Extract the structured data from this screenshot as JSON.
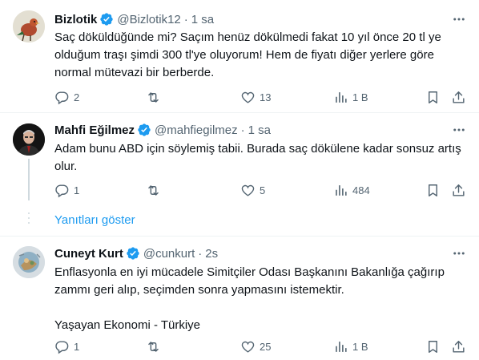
{
  "tweets": [
    {
      "name": "Bizlotik",
      "handle": "@Bizlotik12",
      "dot": "·",
      "time": "1 sa",
      "text": "Saç döküldüğünde mi? Saçım henüz dökülmedi fakat 10 yıl önce 20 tl ye olduğum traşı şimdi 300 tl'ye oluyorum! Hem de fiyatı diğer yerlere göre normal mütevazi bir berberde.",
      "replies": "2",
      "retweets": "",
      "likes": "13",
      "views": "1 B"
    },
    {
      "name": "Mahfi Eğilmez",
      "handle": "@mahfiegilmez",
      "dot": "·",
      "time": "1 sa",
      "text": "Adam bunu ABD için söylemiş tabii. Burada saç dökülene kadar sonsuz artış olur.",
      "replies": "1",
      "retweets": "",
      "likes": "5",
      "views": "484"
    },
    {
      "name": "Cuneyt Kurt",
      "handle": "@cunkurt",
      "dot": "·",
      "time": "2s",
      "text": "Enflasyonla en iyi mücadele Simitçiler Odası Başkanını Bakanlığa çağırıp zammı geri alıp, seçimden sonra yapmasını istemektir.\n\nYaşayan Ekonomi - Türkiye",
      "replies": "1",
      "retweets": "",
      "likes": "25",
      "views": "1 B"
    }
  ],
  "show_replies_label": "Yanıtları göster",
  "colors": {
    "accent": "#1d9bf0",
    "muted": "#536471",
    "text": "#0f1419",
    "divider": "#eff3f4"
  },
  "icons": [
    "verified-badge-icon",
    "more-icon",
    "reply-icon",
    "retweet-icon",
    "like-icon",
    "views-icon",
    "bookmark-icon",
    "share-icon"
  ]
}
